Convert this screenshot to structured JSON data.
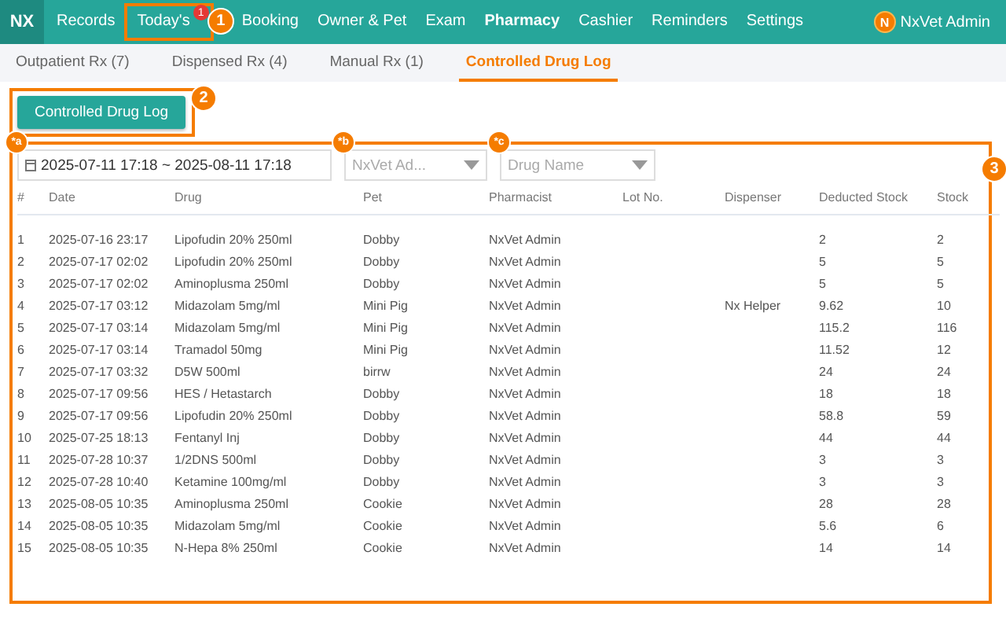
{
  "top_nav": {
    "logo": "NX",
    "items": [
      {
        "label": "Records",
        "selected": false
      },
      {
        "label": "Today's",
        "selected": false,
        "badge": "1",
        "callout": "1"
      },
      {
        "label": "Booking",
        "selected": false
      },
      {
        "label": "Owner & Pet",
        "selected": false
      },
      {
        "label": "Exam",
        "selected": false
      },
      {
        "label": "Pharmacy",
        "selected": true
      },
      {
        "label": "Cashier",
        "selected": false
      },
      {
        "label": "Reminders",
        "selected": false
      },
      {
        "label": "Settings",
        "selected": false
      }
    ],
    "user": {
      "avatar": "N",
      "name": "NxVet Admin"
    }
  },
  "sub_tabs": [
    {
      "label": "Outpatient Rx (7)",
      "selected": false
    },
    {
      "label": "Dispensed Rx (4)",
      "selected": false
    },
    {
      "label": "Manual Rx (1)",
      "selected": false
    },
    {
      "label": "Controlled Drug Log",
      "selected": true
    }
  ],
  "log_button": {
    "label": "Controlled Drug Log",
    "callout": "2"
  },
  "panel_callout": "3",
  "filters": [
    {
      "kind": "date",
      "value": "2025-07-11 17:18 ~ 2025-08-11 17:18",
      "marker": "*a"
    },
    {
      "kind": "select",
      "value": "NxVet Ad...",
      "marker": "*b"
    },
    {
      "kind": "select",
      "placeholder": "Drug Name",
      "marker": "*c"
    }
  ],
  "table": {
    "columns": [
      "#",
      "Date",
      "Drug",
      "Pet",
      "Pharmacist",
      "Lot No.",
      "Dispenser",
      "Deducted Stock",
      "Stock"
    ],
    "rows": [
      [
        "1",
        "2025-07-16 23:17",
        "Lipofudin 20% 250ml",
        "Dobby",
        "NxVet Admin",
        "",
        "",
        "2",
        "2"
      ],
      [
        "2",
        "2025-07-17 02:02",
        "Lipofudin 20% 250ml",
        "Dobby",
        "NxVet Admin",
        "",
        "",
        "5",
        "5"
      ],
      [
        "3",
        "2025-07-17 02:02",
        "Aminoplusma 250ml",
        "Dobby",
        "NxVet Admin",
        "",
        "",
        "5",
        "5"
      ],
      [
        "4",
        "2025-07-17 03:12",
        "Midazolam 5mg/ml",
        "Mini Pig",
        "NxVet Admin",
        "",
        "Nx Helper",
        "9.62",
        "10"
      ],
      [
        "5",
        "2025-07-17 03:14",
        "Midazolam 5mg/ml",
        "Mini Pig",
        "NxVet Admin",
        "",
        "",
        "115.2",
        "116"
      ],
      [
        "6",
        "2025-07-17 03:14",
        "Tramadol 50mg",
        "Mini Pig",
        "NxVet Admin",
        "",
        "",
        "11.52",
        "12"
      ],
      [
        "7",
        "2025-07-17 03:32",
        "D5W 500ml",
        "birrw",
        "NxVet Admin",
        "",
        "",
        "24",
        "24"
      ],
      [
        "8",
        "2025-07-17 09:56",
        "HES / Hetastarch",
        "Dobby",
        "NxVet Admin",
        "",
        "",
        "18",
        "18"
      ],
      [
        "9",
        "2025-07-17 09:56",
        "Lipofudin 20% 250ml",
        "Dobby",
        "NxVet Admin",
        "",
        "",
        "58.8",
        "59"
      ],
      [
        "10",
        "2025-07-25 18:13",
        "Fentanyl Inj",
        "Dobby",
        "NxVet Admin",
        "",
        "",
        "44",
        "44"
      ],
      [
        "11",
        "2025-07-28 10:37",
        "1/2DNS 500ml",
        "Dobby",
        "NxVet Admin",
        "",
        "",
        "3",
        "3"
      ],
      [
        "12",
        "2025-07-28 10:40",
        "Ketamine 100mg/ml",
        "Dobby",
        "NxVet Admin",
        "",
        "",
        "3",
        "3"
      ],
      [
        "13",
        "2025-08-05 10:35",
        "Aminoplusma 250ml",
        "Cookie",
        "NxVet Admin",
        "",
        "",
        "28",
        "28"
      ],
      [
        "14",
        "2025-08-05 10:35",
        "Midazolam 5mg/ml",
        "Cookie",
        "NxVet Admin",
        "",
        "",
        "5.6",
        "6"
      ],
      [
        "15",
        "2025-08-05 10:35",
        "N-Hepa 8% 250ml",
        "Cookie",
        "NxVet Admin",
        "",
        "",
        "14",
        "14"
      ]
    ]
  }
}
